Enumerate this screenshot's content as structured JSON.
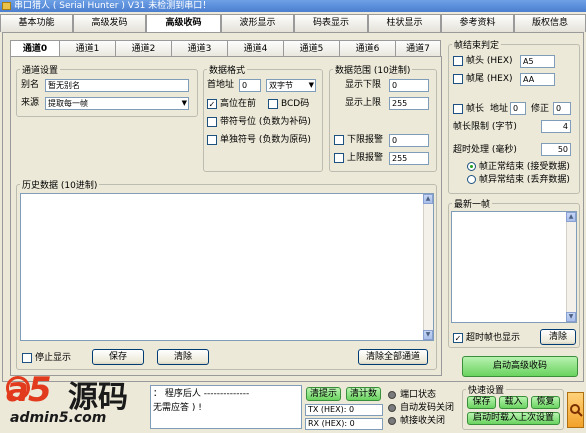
{
  "window": {
    "title": "串口猎人 ( Serial Hunter ) V31    未检测到串口！"
  },
  "main_tabs": [
    {
      "label": "基本功能",
      "active": false
    },
    {
      "label": "高级发码",
      "active": false
    },
    {
      "label": "高级收码",
      "active": true
    },
    {
      "label": "波形显示",
      "active": false
    },
    {
      "label": "码表显示",
      "active": false
    },
    {
      "label": "柱状显示",
      "active": false
    },
    {
      "label": "参考资料",
      "active": false
    },
    {
      "label": "版权信息",
      "active": false
    }
  ],
  "sub_tabs": [
    {
      "label": "通道0",
      "active": true
    },
    {
      "label": "通道1",
      "active": false
    },
    {
      "label": "通道2",
      "active": false
    },
    {
      "label": "通道3",
      "active": false
    },
    {
      "label": "通道4",
      "active": false
    },
    {
      "label": "通道5",
      "active": false
    },
    {
      "label": "通道6",
      "active": false
    },
    {
      "label": "通道7",
      "active": false
    }
  ],
  "channel_settings": {
    "title": "通道设置",
    "alias_label": "别名",
    "alias_value": "暂无别名",
    "source_label": "来源",
    "source_value": "提取每一帧"
  },
  "data_format": {
    "title": "数据格式",
    "start_addr_label": "首地址",
    "start_addr_value": "0",
    "byte_type_value": "双字节",
    "high_first_label": "高位在前",
    "high_first_checked": true,
    "bcd_label": "BCD码",
    "bcd_checked": false,
    "signed_label": "带符号位 (负数为补码)",
    "signed_checked": false,
    "unsigned_sign_label": "单独符号 (负数为原码)",
    "unsigned_sign_checked": false
  },
  "data_range": {
    "title": "数据范围 (10进制)",
    "lower_label": "显示下限",
    "lower_value": "0",
    "upper_label": "显示上限",
    "upper_value": "255",
    "lower_alarm_label": "下限报警",
    "lower_alarm_value": "0",
    "upper_alarm_label": "上限报警",
    "upper_alarm_value": "255"
  },
  "history": {
    "title": "历史数据 (10进制)",
    "stop_display_label": "停止显示",
    "save_label": "保存",
    "clear_label": "清除",
    "clear_all_label": "清除全部通道"
  },
  "frame_end": {
    "title": "帧结束判定",
    "header_label": "帧头 (HEX)",
    "header_value": "A5",
    "tail_label": "帧尾 (HEX)",
    "tail_value": "AA",
    "length_label": "帧长",
    "addr_label": "地址",
    "addr_value": "0",
    "correct_label": "修正",
    "correct_value": "0",
    "length_limit_label": "帧长限制 (字节)",
    "length_limit_value": "4",
    "timeout_label": "超时处理 (毫秒)",
    "timeout_value": "50",
    "radio_normal_label": "帧正常结束 (接受数据)",
    "radio_abnormal_label": "帧异常结束 (丢弃数据)"
  },
  "latest_frame": {
    "title": "最新一帧",
    "realtime_label": "超时帧也显示",
    "realtime_checked": true,
    "clear_label": "清除",
    "start_label": "启动高级收码"
  },
  "status": {
    "message_line1": "： 程序后人 --------------",
    "message_line2": "无需应答 ) !",
    "clear_tip_label": "清提示",
    "clear_count_label": "清计数",
    "tx_label": "TX (HEX): 0",
    "rx_label": "RX (HEX): 0",
    "port_state_label": "端口状态",
    "auto_send_label": "自动发码关闭",
    "frame_recv_label": "帧接收关闭"
  },
  "quick_settings": {
    "title": "快速设置",
    "save_label": "保存",
    "load_label": "载入",
    "restore_label": "恢复",
    "startup_label": "启动时载入上次设置"
  },
  "watermark": {
    "brand": "a5",
    "brand_cn": "源码",
    "domain": "admin5.com"
  },
  "colors": {
    "accent_green": "#6ad35f",
    "alarm_red": "#e23a1c"
  }
}
